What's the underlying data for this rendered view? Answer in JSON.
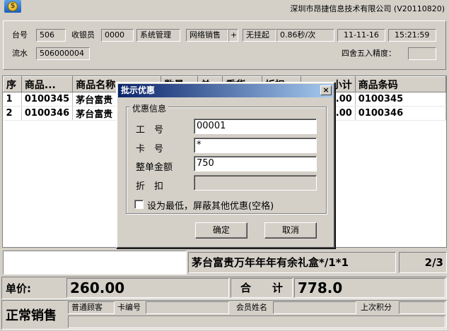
{
  "header": {
    "company": "深圳市昂捷信息技术有限公司 (V20110820)"
  },
  "info": {
    "terminal_label": "台号",
    "terminal_value": "506",
    "cashier_label": "收银员",
    "cashier_value": "0000",
    "mgmt_label": "系统管理",
    "network_label": "网络销售",
    "network_sign": "+",
    "hang_label": "无挂起",
    "speed": "0.86秒/次",
    "date": "11-11-16",
    "time": "15:21:59",
    "serial_label": "流水",
    "serial_value": "506000004",
    "rounding_label": "四舍五入精度：",
    "rounding_value": ""
  },
  "grid": {
    "columns": [
      "序",
      "商品...",
      "商品名称",
      "数量",
      "单",
      "重货",
      "折扣",
      "小计",
      "商品条码"
    ],
    "rows": [
      {
        "seq": "1",
        "code": "0100345",
        "name": "茅台富贵",
        "subtotal": ".00",
        "barcode": "0100345"
      },
      {
        "seq": "2",
        "code": "0100346",
        "name": "茅台富贵",
        "subtotal": ".00",
        "barcode": "0100346"
      }
    ]
  },
  "bottom": {
    "item_desc": "茅台富贵万年年年有余礼盒*/1*1",
    "page": "2/3",
    "unit_price_label": "单价:",
    "unit_price": "260.00",
    "total_label": "合　　计",
    "total": "778.0",
    "mode": "正常销售",
    "customer_type": "普通顾客",
    "card_label": "卡编号",
    "card_value": "",
    "member_label": "会员姓名",
    "member_value": "",
    "points_label": "上次积分",
    "points_value": ""
  },
  "dialog": {
    "title": "批示优惠",
    "close_glyph": "×",
    "group_label": "优惠信息",
    "staff_label": "工　号",
    "staff_value": "00001",
    "card_label": "卡　号",
    "card_value": "*",
    "amount_label": "整单金额",
    "amount_value": "750",
    "discount_label": "折　扣",
    "discount_value": "",
    "lowest_label": "设为最低，屏蔽其他优惠(空格)",
    "ok_label": "确定",
    "cancel_label": "取消"
  }
}
